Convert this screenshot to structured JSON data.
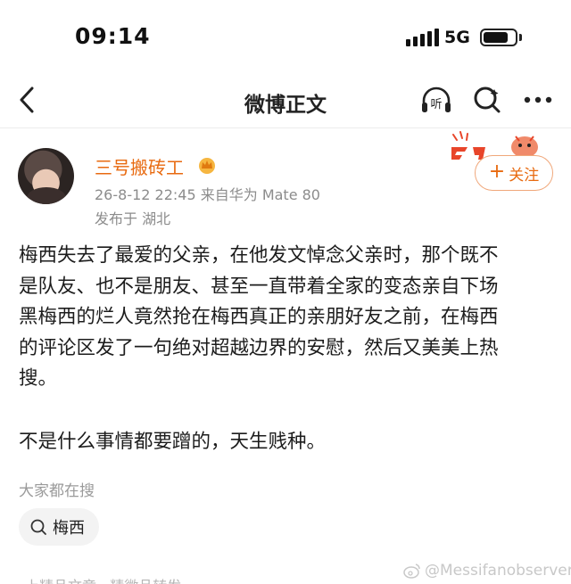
{
  "status_bar": {
    "time": "09:14",
    "network": "5G",
    "battery_level": 0.8
  },
  "nav": {
    "title": "微博正文",
    "back_icon": "chevron-left-icon",
    "listen_icon": "listen-icon",
    "search_icon": "search-icon",
    "more_icon": "more-dots-icon"
  },
  "author": {
    "name": "三号搬砖工",
    "badge_icon": "crown-badge-icon",
    "meta": "26-8-12 22:45   来自华为 Mate 80",
    "location": "发布于  湖北",
    "follow_label": "关注",
    "follow_plus": "+"
  },
  "post": {
    "body": "梅西失去了最爱的父亲，在他发文悼念父亲时，那个既不\n是队友、也不是朋友、甚至一直带着全家的变态亲自下场\n黑梅西的烂人竟然抢在梅西真正的亲朋好友之前，在梅西\n的评论区发了一句绝对超越边界的安慰，然后又美美上热\n搜。",
    "tail": "不是什么事情都要蹭的，天生贱种。"
  },
  "search": {
    "section_title": "大家都在搜",
    "chips": [
      {
        "label": "梅西"
      }
    ]
  },
  "footer": {
    "cut_text": "上精品文章 · 精微品转发",
    "watermark": "@Messifanobserver"
  },
  "colors": {
    "accent": "#e86a10",
    "follow_border": "#f0a77a",
    "meta_gray": "#8c8c8c"
  }
}
